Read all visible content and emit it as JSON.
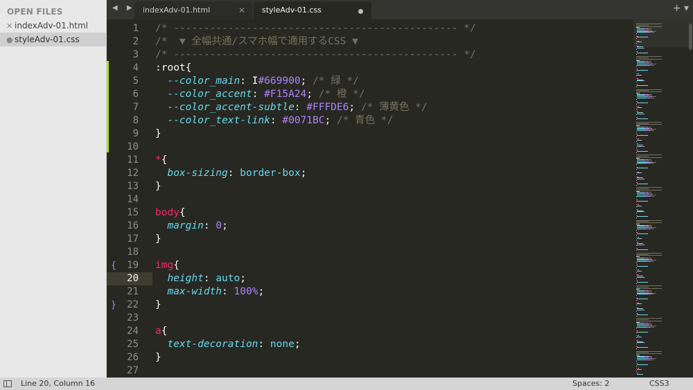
{
  "sidebar": {
    "title": "OPEN FILES",
    "files": [
      {
        "name": "indexAdv-01.html",
        "mark": "✕",
        "active": false
      },
      {
        "name": "styleAdv-01.css",
        "mark": "●",
        "active": true
      }
    ]
  },
  "tabs": [
    {
      "label": "indexAdv-01.html",
      "close": "✕"
    },
    {
      "label": "styleAdv-01.css"
    }
  ],
  "toolbar": {
    "nav": "◀ ▶",
    "tools": "+ ▾"
  },
  "editor": {
    "current_line": 20,
    "lines": [
      {
        "n": "1",
        "tokens": [
          {
            "t": "/* ----------------------------------------------- */",
            "c": "c-comment"
          }
        ]
      },
      {
        "n": "2",
        "tokens": [
          {
            "t": "/*  ▼ 全幅共通/スマホ幅で適用するCSS ▼",
            "c": "c-comment"
          }
        ]
      },
      {
        "n": "3",
        "tokens": [
          {
            "t": "/* ----------------------------------------------- */",
            "c": "c-comment"
          }
        ]
      },
      {
        "n": "4",
        "tokens": [
          {
            "t": ":root",
            "c": "c-white"
          },
          {
            "t": "{",
            "c": "c-white"
          }
        ]
      },
      {
        "n": "5",
        "tokens": [
          {
            "t": "  ",
            "c": "c-white"
          },
          {
            "t": "--color_main",
            "c": "c-prop"
          },
          {
            "t": ": ",
            "c": "c-white"
          },
          {
            "t": "I",
            "c": "cursor-i"
          },
          {
            "t": "#669900",
            "c": "c-num"
          },
          {
            "t": "; ",
            "c": "c-white"
          },
          {
            "t": "/* 緑 */",
            "c": "c-comment"
          }
        ]
      },
      {
        "n": "6",
        "tokens": [
          {
            "t": "  ",
            "c": "c-white"
          },
          {
            "t": "--color_accent",
            "c": "c-prop"
          },
          {
            "t": ": ",
            "c": "c-white"
          },
          {
            "t": "#F15A24",
            "c": "c-num"
          },
          {
            "t": "; ",
            "c": "c-white"
          },
          {
            "t": "/* 橙 */",
            "c": "c-comment"
          }
        ]
      },
      {
        "n": "7",
        "tokens": [
          {
            "t": "  ",
            "c": "c-white"
          },
          {
            "t": "--color_accent-subtle",
            "c": "c-prop"
          },
          {
            "t": ": ",
            "c": "c-white"
          },
          {
            "t": "#FFFDE6",
            "c": "c-num"
          },
          {
            "t": "; ",
            "c": "c-white"
          },
          {
            "t": "/* 薄黄色 */",
            "c": "c-comment"
          }
        ]
      },
      {
        "n": "8",
        "tokens": [
          {
            "t": "  ",
            "c": "c-white"
          },
          {
            "t": "--color_text-link",
            "c": "c-prop"
          },
          {
            "t": ": ",
            "c": "c-white"
          },
          {
            "t": "#0071BC",
            "c": "c-num"
          },
          {
            "t": "; ",
            "c": "c-white"
          },
          {
            "t": "/* 青色 */",
            "c": "c-comment"
          }
        ]
      },
      {
        "n": "9",
        "tokens": [
          {
            "t": "}",
            "c": "c-white"
          }
        ]
      },
      {
        "n": "10",
        "tokens": []
      },
      {
        "n": "11",
        "tokens": [
          {
            "t": "*",
            "c": "c-tag"
          },
          {
            "t": "{",
            "c": "c-white"
          }
        ]
      },
      {
        "n": "12",
        "tokens": [
          {
            "t": "  ",
            "c": "c-white"
          },
          {
            "t": "box-sizing",
            "c": "c-prop"
          },
          {
            "t": ": ",
            "c": "c-white"
          },
          {
            "t": "border-box",
            "c": "c-val"
          },
          {
            "t": ";",
            "c": "c-white"
          }
        ]
      },
      {
        "n": "13",
        "tokens": [
          {
            "t": "}",
            "c": "c-white"
          }
        ]
      },
      {
        "n": "14",
        "tokens": []
      },
      {
        "n": "15",
        "tokens": [
          {
            "t": "body",
            "c": "c-tag"
          },
          {
            "t": "{",
            "c": "c-white"
          }
        ]
      },
      {
        "n": "16",
        "tokens": [
          {
            "t": "  ",
            "c": "c-white"
          },
          {
            "t": "margin",
            "c": "c-prop"
          },
          {
            "t": ": ",
            "c": "c-white"
          },
          {
            "t": "0",
            "c": "c-num"
          },
          {
            "t": ";",
            "c": "c-white"
          }
        ]
      },
      {
        "n": "17",
        "tokens": [
          {
            "t": "}",
            "c": "c-white"
          }
        ]
      },
      {
        "n": "18",
        "tokens": []
      },
      {
        "n": "19",
        "fold": "{",
        "tokens": [
          {
            "t": "img",
            "c": "c-tag"
          },
          {
            "t": "{",
            "c": "c-white"
          }
        ]
      },
      {
        "n": "20",
        "tokens": [
          {
            "t": "  ",
            "c": "c-white"
          },
          {
            "t": "height",
            "c": "c-prop"
          },
          {
            "t": ": ",
            "c": "c-white"
          },
          {
            "t": "auto",
            "c": "c-val"
          },
          {
            "t": ";",
            "c": "c-white"
          }
        ]
      },
      {
        "n": "21",
        "tokens": [
          {
            "t": "  ",
            "c": "c-white"
          },
          {
            "t": "max-width",
            "c": "c-prop"
          },
          {
            "t": ": ",
            "c": "c-white"
          },
          {
            "t": "100%",
            "c": "c-num"
          },
          {
            "t": ";",
            "c": "c-white"
          }
        ]
      },
      {
        "n": "22",
        "fold": "}",
        "tokens": [
          {
            "t": "}",
            "c": "c-white"
          }
        ]
      },
      {
        "n": "23",
        "tokens": []
      },
      {
        "n": "24",
        "tokens": [
          {
            "t": "a",
            "c": "c-tag"
          },
          {
            "t": "{",
            "c": "c-white"
          }
        ]
      },
      {
        "n": "25",
        "tokens": [
          {
            "t": "  ",
            "c": "c-white"
          },
          {
            "t": "text-decoration",
            "c": "c-prop"
          },
          {
            "t": ": ",
            "c": "c-white"
          },
          {
            "t": "none",
            "c": "c-val"
          },
          {
            "t": ";",
            "c": "c-white"
          }
        ]
      },
      {
        "n": "26",
        "tokens": [
          {
            "t": "}",
            "c": "c-white"
          }
        ]
      },
      {
        "n": "27",
        "tokens": []
      }
    ]
  },
  "statusbar": {
    "position": "Line 20, Column 16",
    "indent": "Spaces: 2",
    "syntax": "CSS3"
  },
  "colors": {
    "background": "#272822",
    "comment": "#75715e",
    "tag": "#f92672",
    "property": "#66d9ef",
    "number": "#ae81ff",
    "modified_marker": "#a6e22e"
  }
}
